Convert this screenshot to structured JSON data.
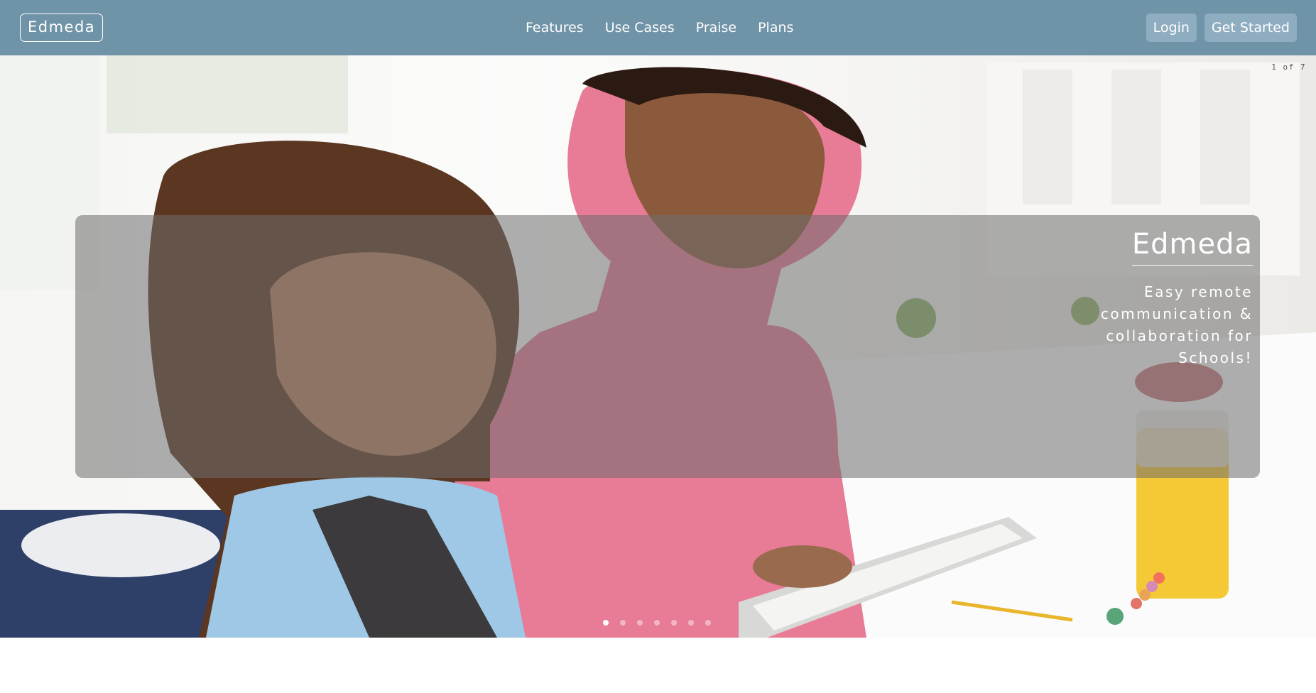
{
  "navbar": {
    "brand": "Edmeda",
    "links": [
      "Features",
      "Use Cases",
      "Praise",
      "Plans"
    ],
    "login_label": "Login",
    "get_started_label": "Get Started",
    "background_color": "#6f93a7"
  },
  "carousel": {
    "counter": "1 of 7",
    "title": "Edmeda",
    "text": "Easy remote communication & collaboration for Schools!",
    "total_slides": 7,
    "active_slide": 1
  }
}
